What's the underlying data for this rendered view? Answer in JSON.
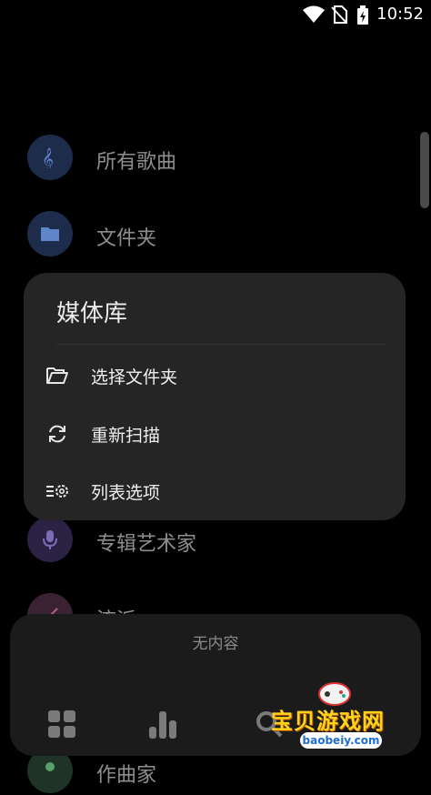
{
  "status_bar": {
    "time": "10:52",
    "icons": [
      "wifi-icon",
      "no-sim-icon",
      "battery-charging-icon"
    ]
  },
  "library_list": [
    {
      "label": "所有歌曲",
      "icon": "treble-clef-icon",
      "color": "#1d2c4a"
    },
    {
      "label": "文件夹",
      "icon": "folder-icon",
      "color": "#1d2c4a"
    },
    {
      "label": "专辑艺术家",
      "icon": "microphone-icon",
      "color": "#2b2244"
    },
    {
      "label": "流派",
      "icon": "guitar-icon",
      "color": "#3a2233"
    },
    {
      "label": "作曲家",
      "icon": "composer-icon",
      "color": "#1f3326"
    }
  ],
  "dialog": {
    "title": "媒体库",
    "items": [
      {
        "label": "选择文件夹",
        "icon": "folder-open-icon"
      },
      {
        "label": "重新扫描",
        "icon": "refresh-icon"
      },
      {
        "label": "列表选项",
        "icon": "list-settings-icon"
      }
    ]
  },
  "bottom_panel": {
    "empty_text": "无内容",
    "nav": [
      "grid-icon",
      "bar-chart-icon",
      "search-icon"
    ]
  },
  "watermark": {
    "text": "宝贝游戏网",
    "url": "baobeiy.com"
  }
}
